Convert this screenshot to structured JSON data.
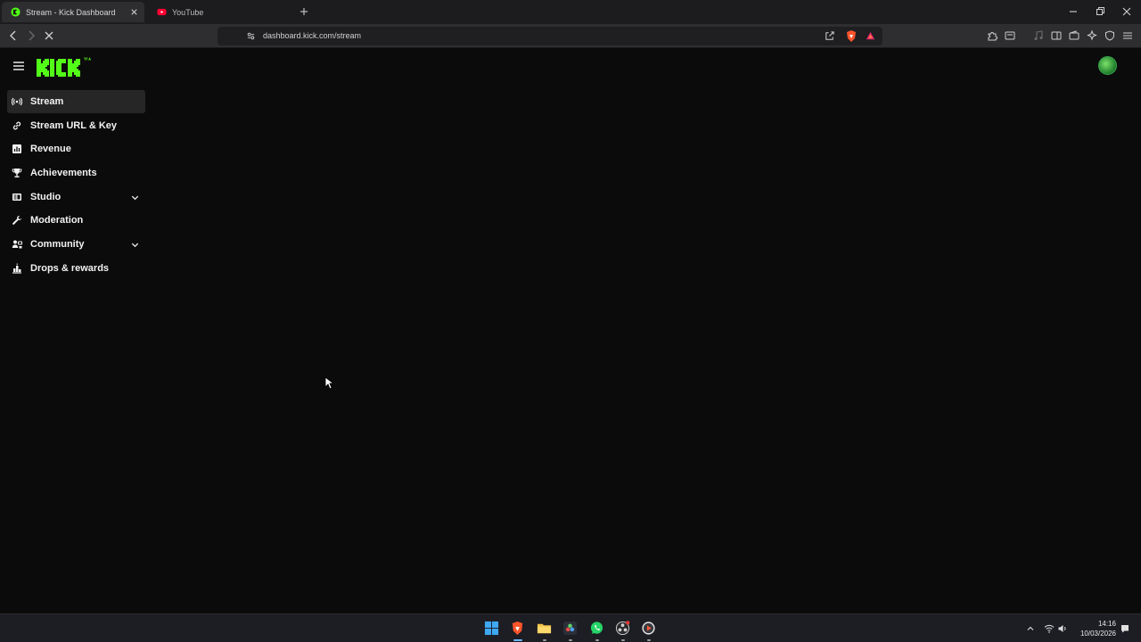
{
  "browser": {
    "tabs": [
      {
        "title": "Stream - Kick Dashboard",
        "active": true
      },
      {
        "title": "YouTube",
        "active": false
      }
    ],
    "url": "dashboard.kick.com/stream"
  },
  "app": {
    "brand_color": "#53fc18"
  },
  "sidebar": {
    "items": [
      {
        "label": "Stream",
        "icon": "broadcast-icon",
        "active": true,
        "expandable": false
      },
      {
        "label": "Stream URL & Key",
        "icon": "link-icon",
        "active": false,
        "expandable": false
      },
      {
        "label": "Revenue",
        "icon": "chart-icon",
        "active": false,
        "expandable": false
      },
      {
        "label": "Achievements",
        "icon": "trophy-icon",
        "active": false,
        "expandable": false
      },
      {
        "label": "Studio",
        "icon": "studio-icon",
        "active": false,
        "expandable": true
      },
      {
        "label": "Moderation",
        "icon": "wrench-icon",
        "active": false,
        "expandable": false
      },
      {
        "label": "Community",
        "icon": "community-icon",
        "active": false,
        "expandable": true
      },
      {
        "label": "Drops & rewards",
        "icon": "drops-icon",
        "active": false,
        "expandable": false
      }
    ]
  },
  "taskbar": {
    "apps": [
      "windows-start-icon",
      "brave-browser-icon",
      "file-explorer-icon",
      "davinci-resolve-icon",
      "whatsapp-icon",
      "obs-icon",
      "media-player-icon"
    ],
    "time": "14:16",
    "date": "10/03/2026"
  }
}
